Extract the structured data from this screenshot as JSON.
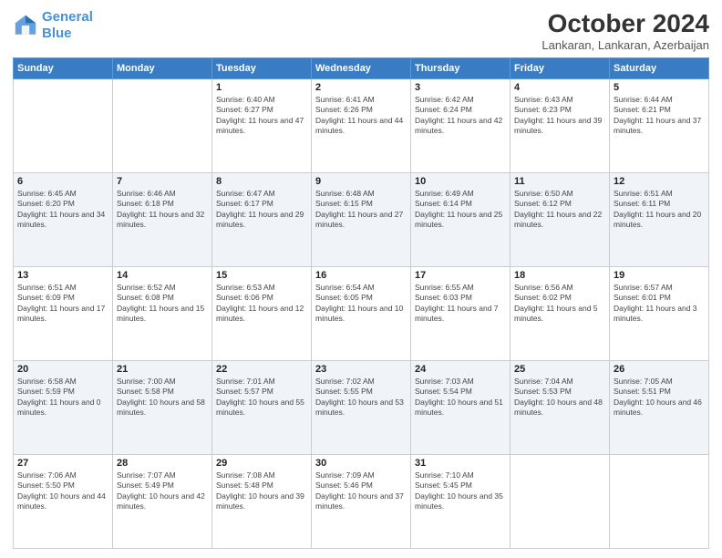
{
  "header": {
    "logo_line1": "General",
    "logo_line2": "Blue",
    "title": "October 2024",
    "subtitle": "Lankaran, Lankaran, Azerbaijan"
  },
  "columns": [
    "Sunday",
    "Monday",
    "Tuesday",
    "Wednesday",
    "Thursday",
    "Friday",
    "Saturday"
  ],
  "weeks": [
    [
      {
        "day": "",
        "sunrise": "",
        "sunset": "",
        "daylight": ""
      },
      {
        "day": "",
        "sunrise": "",
        "sunset": "",
        "daylight": ""
      },
      {
        "day": "1",
        "sunrise": "Sunrise: 6:40 AM",
        "sunset": "Sunset: 6:27 PM",
        "daylight": "Daylight: 11 hours and 47 minutes."
      },
      {
        "day": "2",
        "sunrise": "Sunrise: 6:41 AM",
        "sunset": "Sunset: 6:26 PM",
        "daylight": "Daylight: 11 hours and 44 minutes."
      },
      {
        "day": "3",
        "sunrise": "Sunrise: 6:42 AM",
        "sunset": "Sunset: 6:24 PM",
        "daylight": "Daylight: 11 hours and 42 minutes."
      },
      {
        "day": "4",
        "sunrise": "Sunrise: 6:43 AM",
        "sunset": "Sunset: 6:23 PM",
        "daylight": "Daylight: 11 hours and 39 minutes."
      },
      {
        "day": "5",
        "sunrise": "Sunrise: 6:44 AM",
        "sunset": "Sunset: 6:21 PM",
        "daylight": "Daylight: 11 hours and 37 minutes."
      }
    ],
    [
      {
        "day": "6",
        "sunrise": "Sunrise: 6:45 AM",
        "sunset": "Sunset: 6:20 PM",
        "daylight": "Daylight: 11 hours and 34 minutes."
      },
      {
        "day": "7",
        "sunrise": "Sunrise: 6:46 AM",
        "sunset": "Sunset: 6:18 PM",
        "daylight": "Daylight: 11 hours and 32 minutes."
      },
      {
        "day": "8",
        "sunrise": "Sunrise: 6:47 AM",
        "sunset": "Sunset: 6:17 PM",
        "daylight": "Daylight: 11 hours and 29 minutes."
      },
      {
        "day": "9",
        "sunrise": "Sunrise: 6:48 AM",
        "sunset": "Sunset: 6:15 PM",
        "daylight": "Daylight: 11 hours and 27 minutes."
      },
      {
        "day": "10",
        "sunrise": "Sunrise: 6:49 AM",
        "sunset": "Sunset: 6:14 PM",
        "daylight": "Daylight: 11 hours and 25 minutes."
      },
      {
        "day": "11",
        "sunrise": "Sunrise: 6:50 AM",
        "sunset": "Sunset: 6:12 PM",
        "daylight": "Daylight: 11 hours and 22 minutes."
      },
      {
        "day": "12",
        "sunrise": "Sunrise: 6:51 AM",
        "sunset": "Sunset: 6:11 PM",
        "daylight": "Daylight: 11 hours and 20 minutes."
      }
    ],
    [
      {
        "day": "13",
        "sunrise": "Sunrise: 6:51 AM",
        "sunset": "Sunset: 6:09 PM",
        "daylight": "Daylight: 11 hours and 17 minutes."
      },
      {
        "day": "14",
        "sunrise": "Sunrise: 6:52 AM",
        "sunset": "Sunset: 6:08 PM",
        "daylight": "Daylight: 11 hours and 15 minutes."
      },
      {
        "day": "15",
        "sunrise": "Sunrise: 6:53 AM",
        "sunset": "Sunset: 6:06 PM",
        "daylight": "Daylight: 11 hours and 12 minutes."
      },
      {
        "day": "16",
        "sunrise": "Sunrise: 6:54 AM",
        "sunset": "Sunset: 6:05 PM",
        "daylight": "Daylight: 11 hours and 10 minutes."
      },
      {
        "day": "17",
        "sunrise": "Sunrise: 6:55 AM",
        "sunset": "Sunset: 6:03 PM",
        "daylight": "Daylight: 11 hours and 7 minutes."
      },
      {
        "day": "18",
        "sunrise": "Sunrise: 6:56 AM",
        "sunset": "Sunset: 6:02 PM",
        "daylight": "Daylight: 11 hours and 5 minutes."
      },
      {
        "day": "19",
        "sunrise": "Sunrise: 6:57 AM",
        "sunset": "Sunset: 6:01 PM",
        "daylight": "Daylight: 11 hours and 3 minutes."
      }
    ],
    [
      {
        "day": "20",
        "sunrise": "Sunrise: 6:58 AM",
        "sunset": "Sunset: 5:59 PM",
        "daylight": "Daylight: 11 hours and 0 minutes."
      },
      {
        "day": "21",
        "sunrise": "Sunrise: 7:00 AM",
        "sunset": "Sunset: 5:58 PM",
        "daylight": "Daylight: 10 hours and 58 minutes."
      },
      {
        "day": "22",
        "sunrise": "Sunrise: 7:01 AM",
        "sunset": "Sunset: 5:57 PM",
        "daylight": "Daylight: 10 hours and 55 minutes."
      },
      {
        "day": "23",
        "sunrise": "Sunrise: 7:02 AM",
        "sunset": "Sunset: 5:55 PM",
        "daylight": "Daylight: 10 hours and 53 minutes."
      },
      {
        "day": "24",
        "sunrise": "Sunrise: 7:03 AM",
        "sunset": "Sunset: 5:54 PM",
        "daylight": "Daylight: 10 hours and 51 minutes."
      },
      {
        "day": "25",
        "sunrise": "Sunrise: 7:04 AM",
        "sunset": "Sunset: 5:53 PM",
        "daylight": "Daylight: 10 hours and 48 minutes."
      },
      {
        "day": "26",
        "sunrise": "Sunrise: 7:05 AM",
        "sunset": "Sunset: 5:51 PM",
        "daylight": "Daylight: 10 hours and 46 minutes."
      }
    ],
    [
      {
        "day": "27",
        "sunrise": "Sunrise: 7:06 AM",
        "sunset": "Sunset: 5:50 PM",
        "daylight": "Daylight: 10 hours and 44 minutes."
      },
      {
        "day": "28",
        "sunrise": "Sunrise: 7:07 AM",
        "sunset": "Sunset: 5:49 PM",
        "daylight": "Daylight: 10 hours and 42 minutes."
      },
      {
        "day": "29",
        "sunrise": "Sunrise: 7:08 AM",
        "sunset": "Sunset: 5:48 PM",
        "daylight": "Daylight: 10 hours and 39 minutes."
      },
      {
        "day": "30",
        "sunrise": "Sunrise: 7:09 AM",
        "sunset": "Sunset: 5:46 PM",
        "daylight": "Daylight: 10 hours and 37 minutes."
      },
      {
        "day": "31",
        "sunrise": "Sunrise: 7:10 AM",
        "sunset": "Sunset: 5:45 PM",
        "daylight": "Daylight: 10 hours and 35 minutes."
      },
      {
        "day": "",
        "sunrise": "",
        "sunset": "",
        "daylight": ""
      },
      {
        "day": "",
        "sunrise": "",
        "sunset": "",
        "daylight": ""
      }
    ]
  ]
}
